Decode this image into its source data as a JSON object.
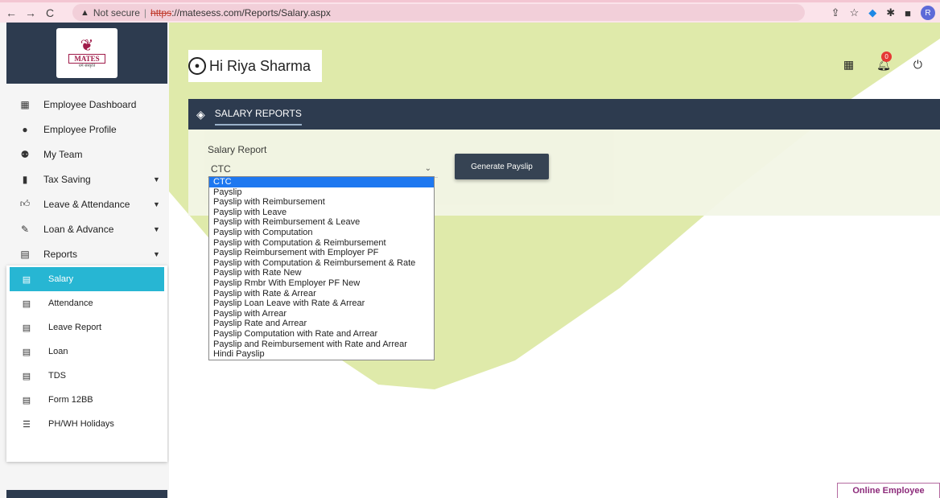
{
  "browser": {
    "back": "←",
    "forward": "→",
    "reload": "C",
    "not_secure": "Not secure",
    "url_scheme": "https",
    "url_rest": "://matesess.com/Reports/Salary.aspx",
    "profile_initial": "R"
  },
  "logo": {
    "text": "MATES",
    "tagline": "धर्म संस्कृति"
  },
  "header": {
    "greeting": "Hi Riya Sharma",
    "notification_count": "0"
  },
  "sidebar": {
    "items": [
      {
        "label": "Employee Dashboard",
        "icon": "grid-icon"
      },
      {
        "label": "Employee Profile",
        "icon": "user-icon"
      },
      {
        "label": "My Team",
        "icon": "users-icon"
      },
      {
        "label": "Tax Saving",
        "icon": "book-icon"
      },
      {
        "label": "Leave & Attendance",
        "icon": "thumbs-up-icon"
      },
      {
        "label": "Loan & Advance",
        "icon": "edit-icon"
      },
      {
        "label": "Reports",
        "icon": "list-icon"
      }
    ],
    "submenu": [
      {
        "label": "Salary",
        "active": true
      },
      {
        "label": "Attendance"
      },
      {
        "label": "Leave Report"
      },
      {
        "label": "Loan"
      },
      {
        "label": "TDS"
      },
      {
        "label": "Form 12BB"
      },
      {
        "label": "PH/WH Holidays"
      }
    ]
  },
  "panel": {
    "title": "SALARY REPORTS",
    "field_label": "Salary Report",
    "selected_value": "CTC",
    "generate_label": "Generate Payslip"
  },
  "dropdown": {
    "options": [
      "CTC",
      "Payslip",
      "Payslip with Reimbursement",
      "Payslip with Leave",
      "Payslip with Reimbursement & Leave",
      "Payslip with Computation",
      "Payslip with Computation & Reimbursement",
      "Payslip Reimbursement with Employer PF",
      "Payslip with Computation & Reimbursement & Rate",
      "Payslip with Rate New",
      "Payslip Rmbr With Employer PF New",
      "Payslip with Rate & Arrear",
      "Payslip Loan Leave with Rate & Arrear",
      "Payslip with Arrear",
      "Payslip Rate and Arrear",
      "Payslip Computation with Rate and Arrear",
      "Payslip and Reimbursement with Rate and Arrear",
      "Hindi Payslip"
    ]
  },
  "footer": {
    "online_label": "Online Employee"
  },
  "colors": {
    "navy": "#2d3b4f",
    "accent": "#27b6d3",
    "lime_bg": "#dfeaaa",
    "selected_option": "#1e78f0"
  }
}
